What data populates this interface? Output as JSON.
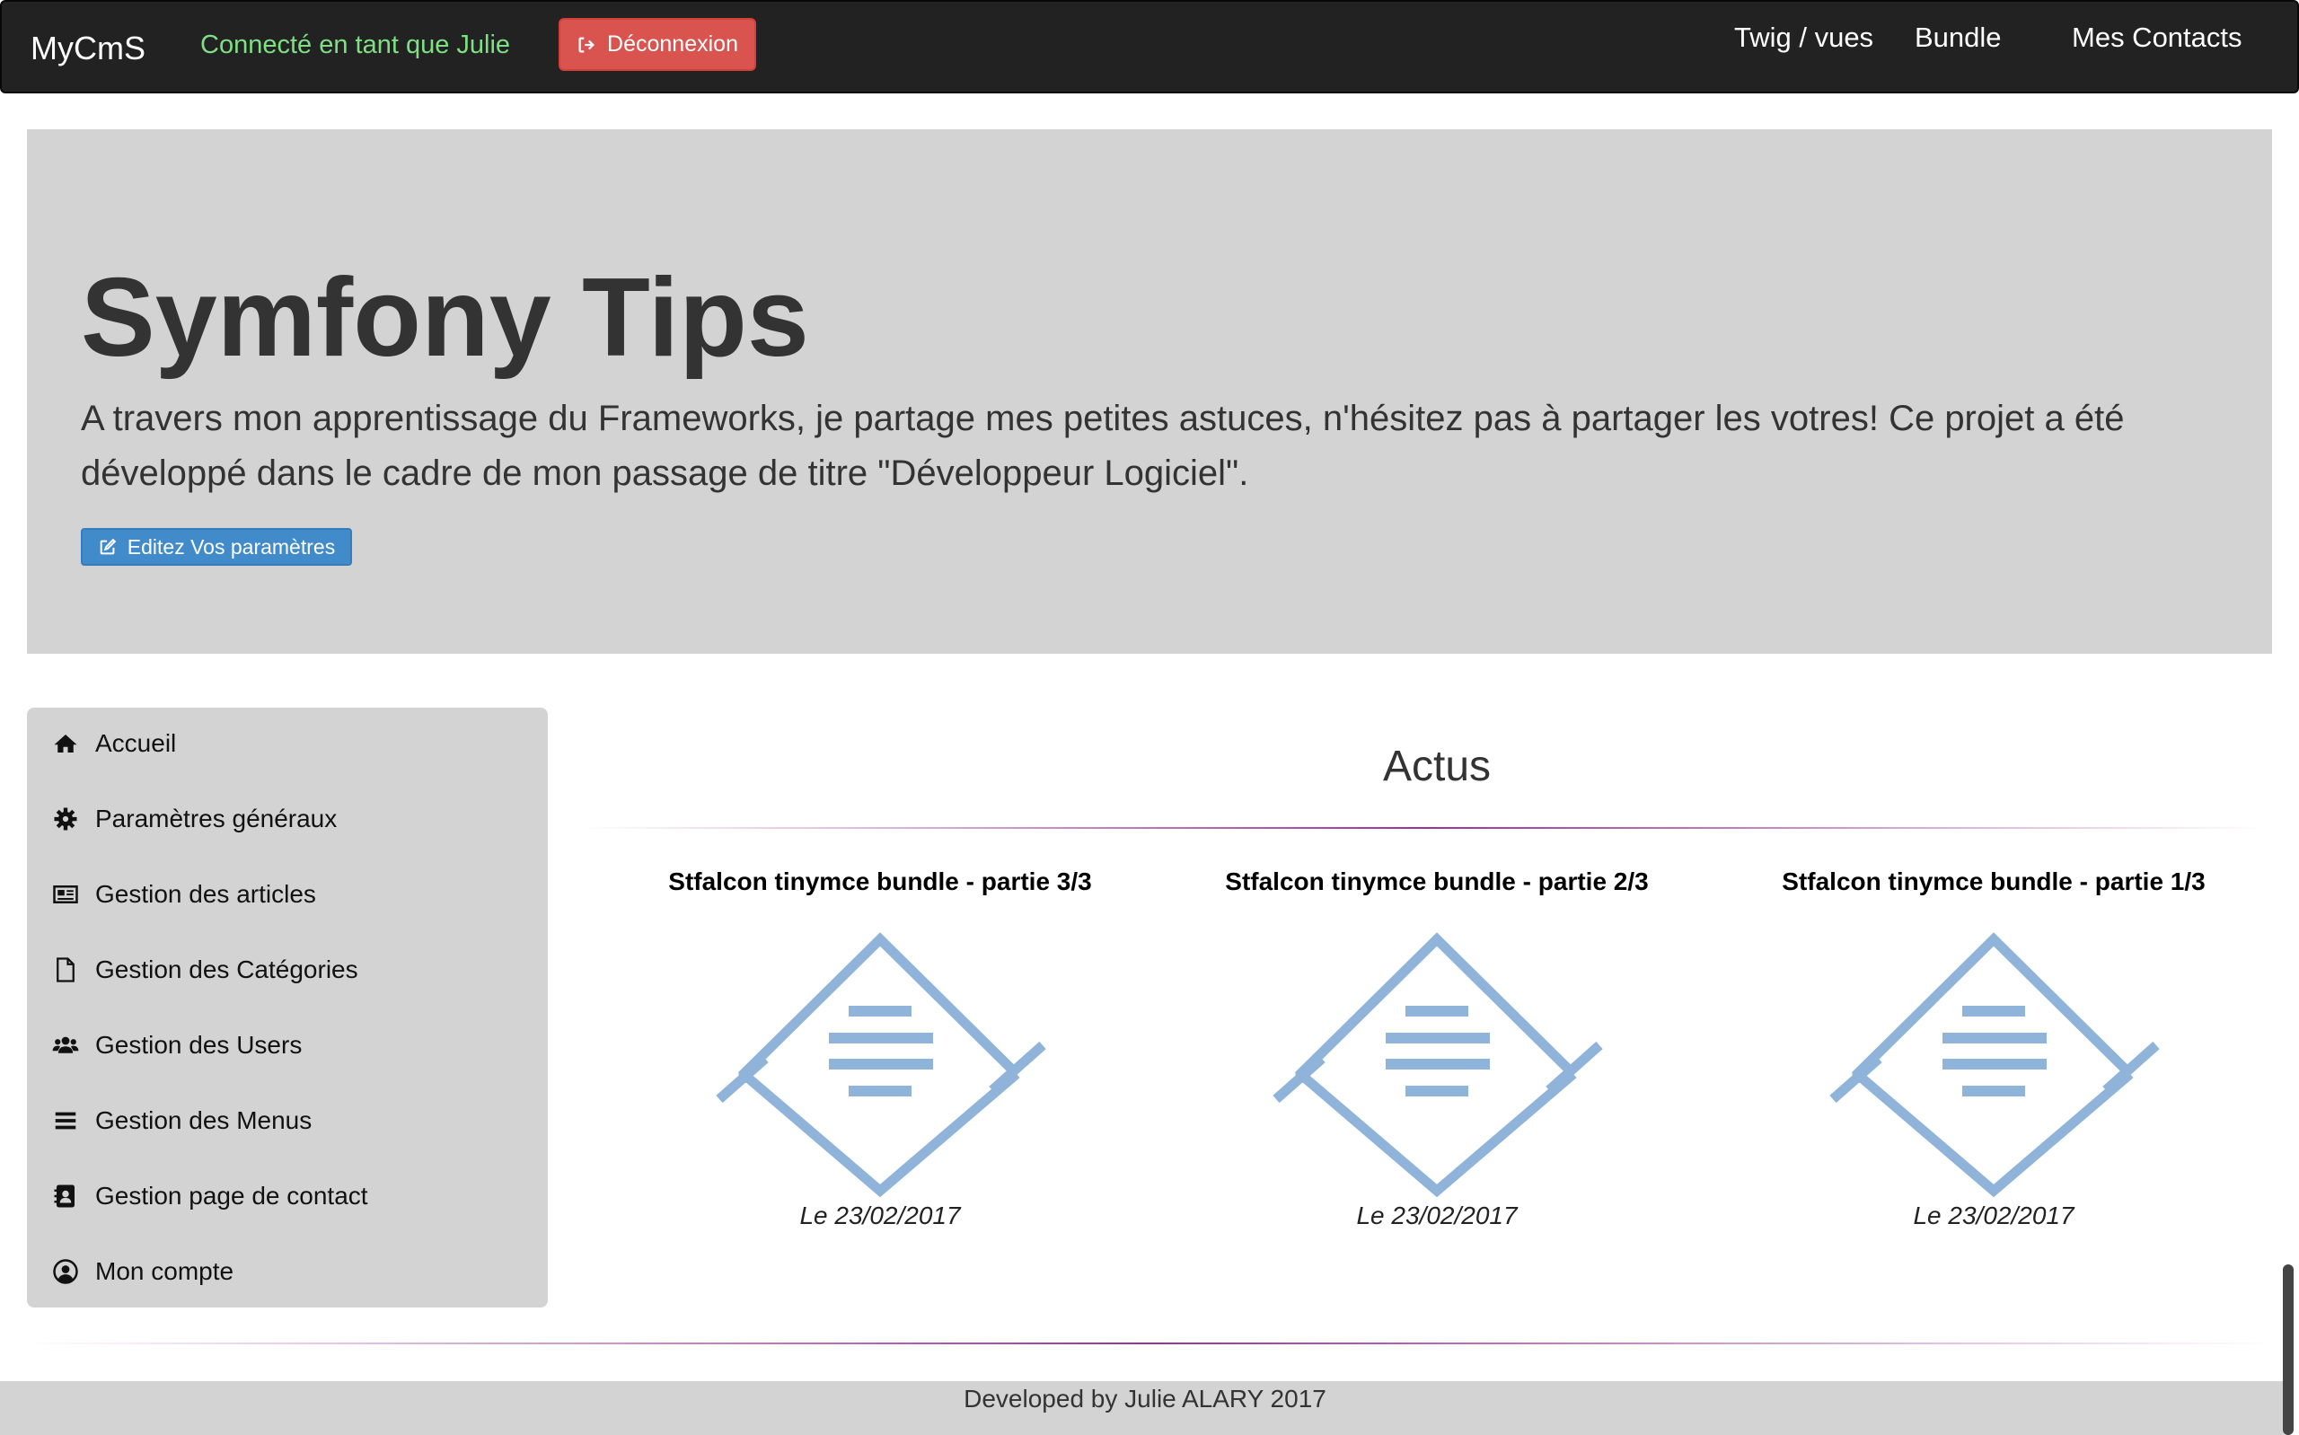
{
  "navbar": {
    "brand": "MyCmS",
    "logged_in_text": "Connecté en tant que Julie",
    "logout_label": "Déconnexion",
    "links": [
      "Twig / vues",
      "Bundle",
      "Mes Contacts"
    ]
  },
  "jumbotron": {
    "title": "Symfony Tips",
    "lead": "A travers mon apprentissage du Frameworks, je partage mes petites astuces, n'hésitez pas à partager les votres! Ce projet a été développé dans le cadre de mon passage de titre \"Développeur Logiciel\".",
    "edit_label": "Editez Vos paramètres"
  },
  "sidebar": {
    "items": [
      {
        "label": "Accueil",
        "icon": "home-icon"
      },
      {
        "label": "Paramètres généraux",
        "icon": "gear-icon"
      },
      {
        "label": "Gestion des articles",
        "icon": "newspaper-icon"
      },
      {
        "label": "Gestion des Catégories",
        "icon": "file-icon"
      },
      {
        "label": "Gestion des Users",
        "icon": "users-icon"
      },
      {
        "label": "Gestion des Menus",
        "icon": "bars-icon"
      },
      {
        "label": "Gestion page de contact",
        "icon": "address-book-icon"
      },
      {
        "label": "Mon compte",
        "icon": "user-circle-icon"
      }
    ]
  },
  "main": {
    "section_title": "Actus",
    "articles": [
      {
        "title": "Stfalcon tinymce bundle - partie 3/3",
        "date": "Le 23/02/2017"
      },
      {
        "title": "Stfalcon tinymce bundle - partie 2/3",
        "date": "Le 23/02/2017"
      },
      {
        "title": "Stfalcon tinymce bundle - partie 1/3",
        "date": "Le 23/02/2017"
      }
    ]
  },
  "footer": {
    "text": "Developed by Julie ALARY 2017"
  },
  "colors": {
    "navbar_bg": "#222222",
    "logged_in_green": "#7ee083",
    "danger": "#d9534f",
    "primary": "#428bca",
    "panel_gray": "#d3d3d3",
    "icon_blue": "#8fb3d9",
    "divider_purple": "#800080"
  }
}
